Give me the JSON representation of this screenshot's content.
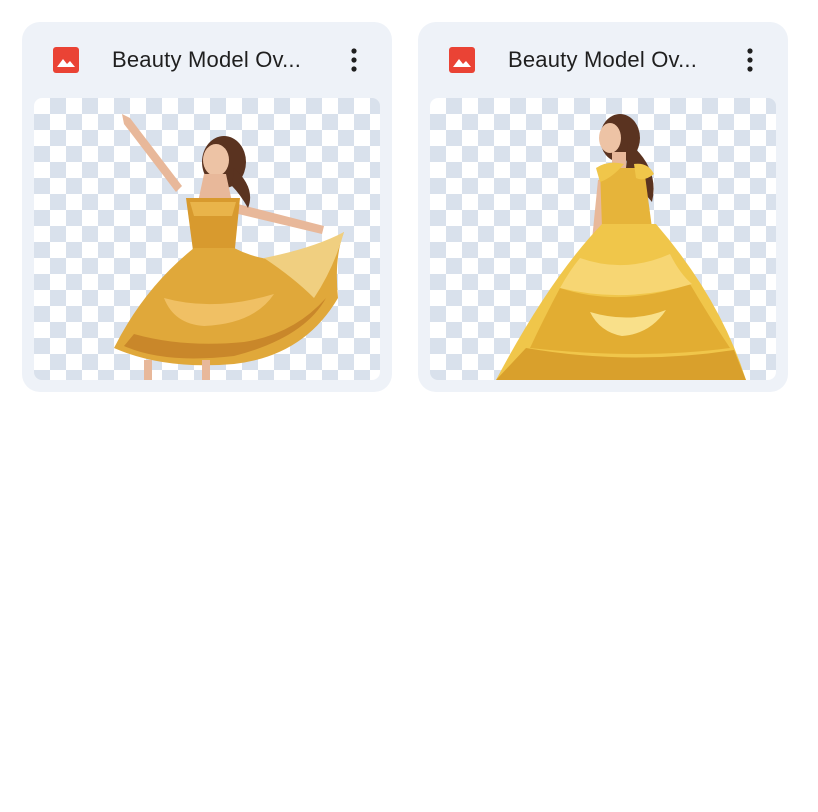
{
  "files": [
    {
      "name": "Beauty Model Ov...",
      "file_icon": "image-file-icon",
      "menu_icon": "more-vert-icon",
      "thumbnail": "dancing woman in flowing golden ruffled gown",
      "icon_color": "#ea4335"
    },
    {
      "name": "Beauty Model Ov...",
      "file_icon": "image-file-icon",
      "menu_icon": "more-vert-icon",
      "thumbnail": "woman from behind in yellow ball gown",
      "icon_color": "#ea4335"
    }
  ],
  "colors": {
    "card_bg": "#eef2f8",
    "text": "#1f1f1f",
    "checker": "#d9e1ec",
    "gown_gold": "#e0a83a",
    "gown_yellow": "#f0c64a"
  }
}
